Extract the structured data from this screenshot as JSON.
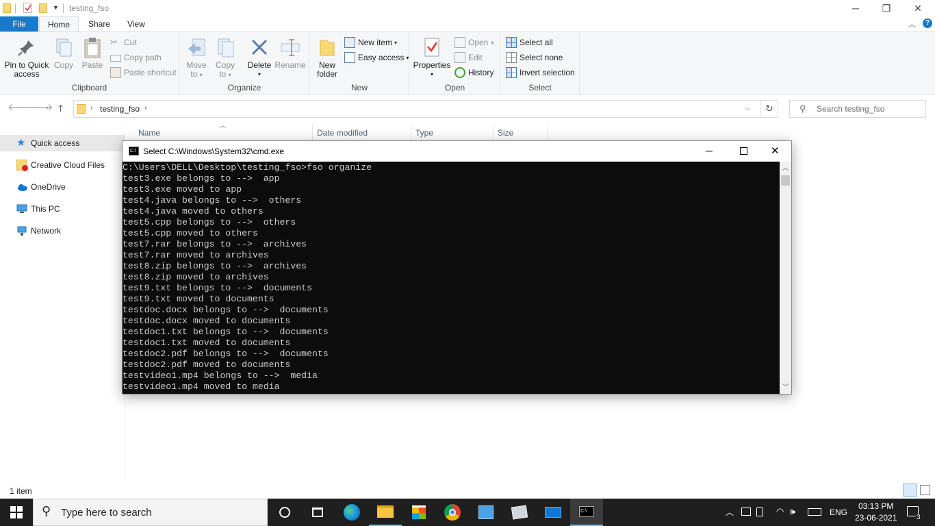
{
  "explorer": {
    "title": "testing_fso",
    "tabs": {
      "file": "File",
      "home": "Home",
      "share": "Share",
      "view": "View"
    },
    "ribbon": {
      "clipboard": {
        "label": "Clipboard",
        "pin": "Pin to Quick access",
        "pin_line1": "Pin to Quick",
        "pin_line2": "access",
        "copy": "Copy",
        "paste": "Paste",
        "cut": "Cut",
        "copy_path": "Copy path",
        "paste_shortcut": "Paste shortcut"
      },
      "organize": {
        "label": "Organize",
        "move_to_1": "Move",
        "move_to_2": "to",
        "copy_to_1": "Copy",
        "copy_to_2": "to",
        "delete": "Delete",
        "rename": "Rename"
      },
      "new": {
        "label": "New",
        "new_folder_1": "New",
        "new_folder_2": "folder",
        "new_item": "New item",
        "easy_access": "Easy access"
      },
      "open": {
        "label": "Open",
        "properties": "Properties",
        "open": "Open",
        "edit": "Edit",
        "history": "History"
      },
      "select": {
        "label": "Select",
        "select_all": "Select all",
        "select_none": "Select none",
        "invert": "Invert selection"
      }
    },
    "address": {
      "path": "testing_fso",
      "search_placeholder": "Search testing_fso"
    },
    "nav": {
      "quick_access": "Quick access",
      "creative_cloud": "Creative Cloud Files",
      "onedrive": "OneDrive",
      "this_pc": "This PC",
      "network": "Network"
    },
    "columns": {
      "name": "Name",
      "date": "Date modified",
      "type": "Type",
      "size": "Size"
    },
    "status": "1 item"
  },
  "cmd": {
    "title": "Select C:\\Windows\\System32\\cmd.exe",
    "lines": [
      "C:\\Users\\DELL\\Desktop\\testing_fso>fso organize",
      "test3.exe belongs to -->  app",
      "test3.exe moved to app",
      "test4.java belongs to -->  others",
      "test4.java moved to others",
      "test5.cpp belongs to -->  others",
      "test5.cpp moved to others",
      "test7.rar belongs to -->  archives",
      "test7.rar moved to archives",
      "test8.zip belongs to -->  archives",
      "test8.zip moved to archives",
      "test9.txt belongs to -->  documents",
      "test9.txt moved to documents",
      "testdoc.docx belongs to -->  documents",
      "testdoc.docx moved to documents",
      "testdoc1.txt belongs to -->  documents",
      "testdoc1.txt moved to documents",
      "testdoc2.pdf belongs to -->  documents",
      "testdoc2.pdf moved to documents",
      "testvideo1.mp4 belongs to -->  media",
      "testvideo1.mp4 moved to media"
    ]
  },
  "taskbar": {
    "search_placeholder": "Type here to search",
    "language": "ENG",
    "time": "03:13 PM",
    "date": "23-06-2021",
    "notifications": "3"
  },
  "colors": {
    "accent": "#1979ca",
    "taskbar": "#1f1f1f",
    "console_bg": "#0c0c0c",
    "console_fg": "#cccccc"
  }
}
